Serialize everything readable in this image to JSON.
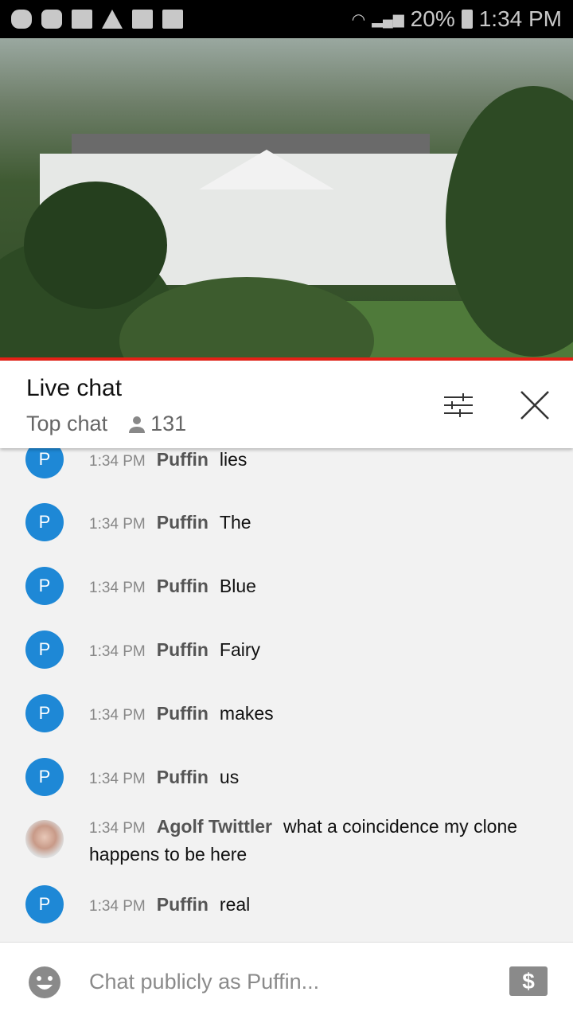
{
  "status_bar": {
    "battery": "20%",
    "time": "1:34 PM",
    "icons": [
      "puffin-icon",
      "youtube-icon",
      "folder-icon",
      "warning-icon",
      "image-icon",
      "news-icon"
    ]
  },
  "chat_header": {
    "title": "Live chat",
    "mode": "Top chat",
    "viewer_count": "131"
  },
  "messages": [
    {
      "time": "1:34 PM",
      "author": "Puffin",
      "text": "lies",
      "avatar": "P"
    },
    {
      "time": "1:34 PM",
      "author": "Puffin",
      "text": "The",
      "avatar": "P"
    },
    {
      "time": "1:34 PM",
      "author": "Puffin",
      "text": "Blue",
      "avatar": "P"
    },
    {
      "time": "1:34 PM",
      "author": "Puffin",
      "text": "Fairy",
      "avatar": "P"
    },
    {
      "time": "1:34 PM",
      "author": "Puffin",
      "text": "makes",
      "avatar": "P"
    },
    {
      "time": "1:34 PM",
      "author": "Puffin",
      "text": "us",
      "avatar": "P"
    },
    {
      "time": "1:34 PM",
      "author": "Agolf Twittler",
      "text": "what a coincidence my clone happens to be here",
      "avatar": ""
    },
    {
      "time": "1:34 PM",
      "author": "Puffin",
      "text": "real",
      "avatar": "P"
    }
  ],
  "input": {
    "placeholder": "Chat publicly as Puffin..."
  },
  "colors": {
    "accent_red": "#e62117",
    "avatar_blue": "#1e88d6"
  }
}
